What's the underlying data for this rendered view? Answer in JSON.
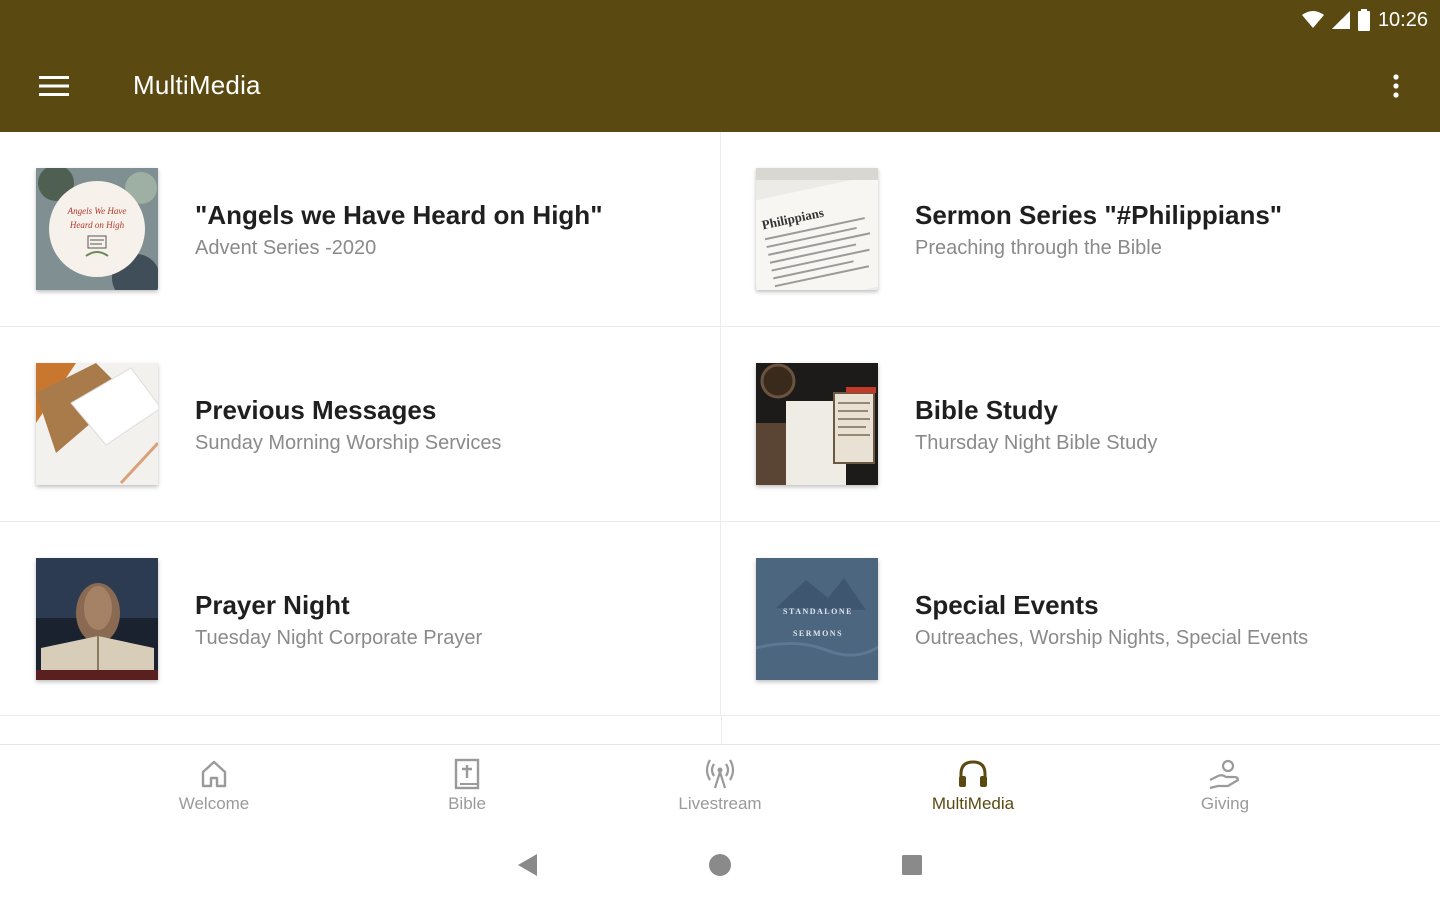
{
  "status_bar": {
    "time": "10:26"
  },
  "app_bar": {
    "title": "MultiMedia",
    "background": "#5a4a12"
  },
  "thumbnails": {
    "angels": {
      "line1": "Angels We Have",
      "line2": "Heard on High"
    },
    "philippians": {
      "text": "Philippians"
    },
    "special": {
      "line1": "STANDALONE",
      "line2": "SERMONS"
    }
  },
  "items": [
    {
      "title": "\"Angels we Have Heard on High\"",
      "subtitle": "Advent Series -2020"
    },
    {
      "title": "Sermon Series \"#Philippians\"",
      "subtitle": "Preaching through the Bible"
    },
    {
      "title": "Previous Messages",
      "subtitle": "Sunday Morning Worship Services"
    },
    {
      "title": "Bible Study",
      "subtitle": "Thursday Night Bible Study"
    },
    {
      "title": "Prayer Night",
      "subtitle": "Tuesday Night Corporate Prayer"
    },
    {
      "title": "Special Events",
      "subtitle": "Outreaches, Worship Nights, Special Events"
    }
  ],
  "bottom_nav": [
    {
      "label": "Welcome",
      "icon": "home-icon"
    },
    {
      "label": "Bible",
      "icon": "bible-icon"
    },
    {
      "label": "Livestream",
      "icon": "broadcast-icon"
    },
    {
      "label": "MultiMedia",
      "icon": "headphones-icon",
      "active": true
    },
    {
      "label": "Giving",
      "icon": "giving-hand-icon"
    }
  ],
  "colors": {
    "accent": "#5a4a12",
    "inactive": "#9a9a9a"
  }
}
